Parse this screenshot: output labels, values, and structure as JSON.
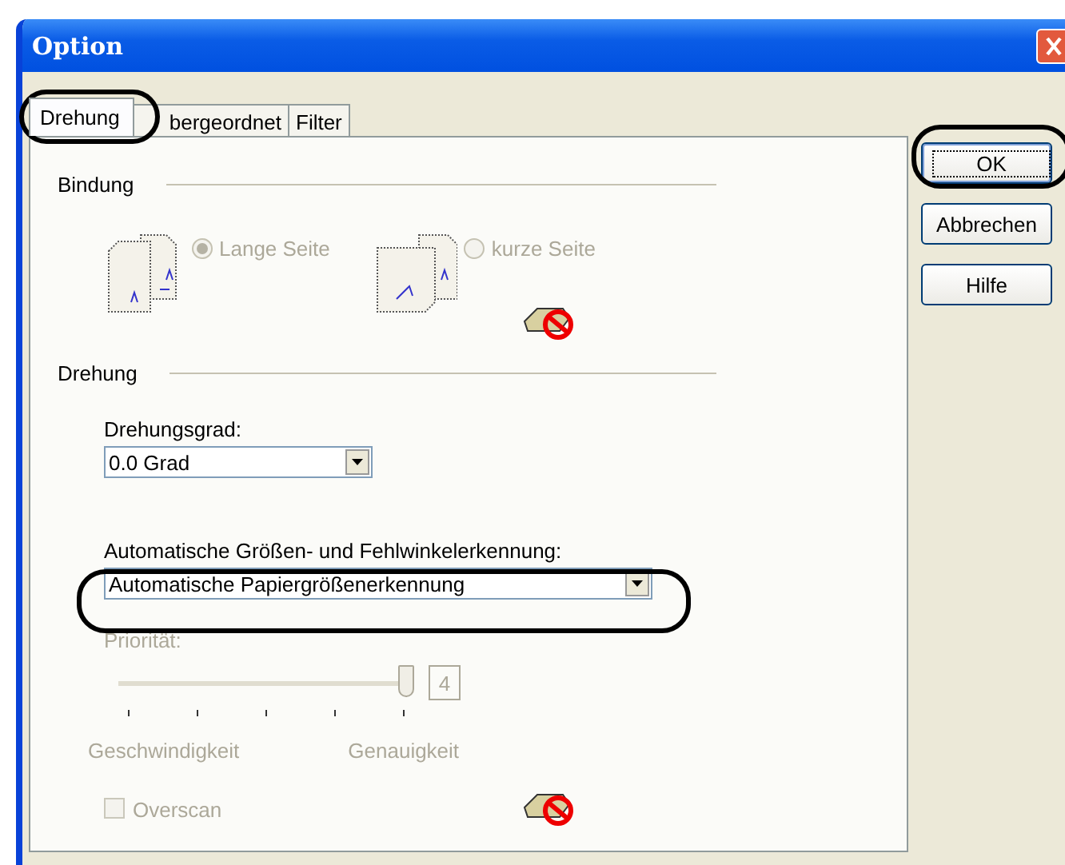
{
  "window": {
    "title": "Option"
  },
  "tabs": [
    {
      "label": "Drehung",
      "selected": true,
      "circled": true
    },
    {
      "label": "bergeordnet",
      "selected": false,
      "circled": false
    },
    {
      "label": "Filter",
      "selected": false,
      "circled": false
    }
  ],
  "bindung": {
    "title": "Bindung",
    "options": [
      {
        "label": "Lange Seite",
        "selected": true,
        "disabled": true
      },
      {
        "label": "kurze Seite",
        "selected": false,
        "disabled": true
      }
    ]
  },
  "drehung": {
    "title": "Drehung",
    "angle_label": "Drehungsgrad:",
    "angle_value": "0.0 Grad",
    "detect_label": "Automatische Größen- und Fehlwinkelerkennung:",
    "detect_value": "Automatische Papiergrößenerkennung",
    "detect_circled": true,
    "priority": {
      "label": "Priorität:",
      "disabled": true,
      "level": 1,
      "reading": "4",
      "min_label": "Geschwindigkeit",
      "max_label": "Genauigkeit"
    },
    "overscan": {
      "label": "Overscan",
      "checked": false,
      "disabled": true
    }
  },
  "buttons": [
    {
      "label": "OK",
      "default": true,
      "circled": true
    },
    {
      "label": "Abbrechen",
      "default": false,
      "circled": false
    },
    {
      "label": "Hilfe",
      "default": false,
      "circled": false
    }
  ]
}
